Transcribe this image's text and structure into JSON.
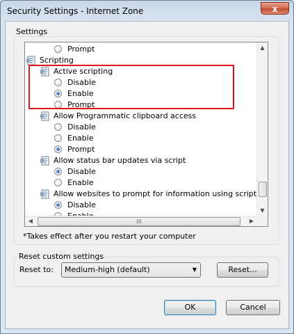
{
  "window": {
    "title": "Security Settings - Internet Zone",
    "close_glyph": "x"
  },
  "settings_group": {
    "label": "Settings"
  },
  "list": {
    "rows": [
      {
        "kind": "radio",
        "label": "Prompt",
        "checked": false
      },
      {
        "kind": "header",
        "label": "Scripting"
      },
      {
        "kind": "header",
        "label": "Active scripting"
      },
      {
        "kind": "radio",
        "label": "Disable",
        "checked": false
      },
      {
        "kind": "radio",
        "label": "Enable",
        "checked": true
      },
      {
        "kind": "radio",
        "label": "Prompt",
        "checked": false
      },
      {
        "kind": "header",
        "label": "Allow Programmatic clipboard access"
      },
      {
        "kind": "radio",
        "label": "Disable",
        "checked": false
      },
      {
        "kind": "radio",
        "label": "Enable",
        "checked": false
      },
      {
        "kind": "radio",
        "label": "Prompt",
        "checked": true
      },
      {
        "kind": "header",
        "label": "Allow status bar updates via script"
      },
      {
        "kind": "radio",
        "label": "Disable",
        "checked": true
      },
      {
        "kind": "radio",
        "label": "Enable",
        "checked": false
      },
      {
        "kind": "header",
        "label": "Allow websites to prompt for information using scripted windo"
      },
      {
        "kind": "radio",
        "label": "Disable",
        "checked": true
      },
      {
        "kind": "radio",
        "label": "Enable",
        "checked": false
      }
    ],
    "hscroll_grip": "III"
  },
  "note": "*Takes effect after you restart your computer",
  "reset_group": {
    "label": "Reset custom settings",
    "reset_to_label": "Reset to:",
    "selected": "Medium-high (default)",
    "reset_button": "Reset..."
  },
  "buttons": {
    "ok": "OK",
    "cancel": "Cancel"
  },
  "colors": {
    "highlight_box": "#e0141e",
    "radio_dot": "#1e4f9e"
  }
}
